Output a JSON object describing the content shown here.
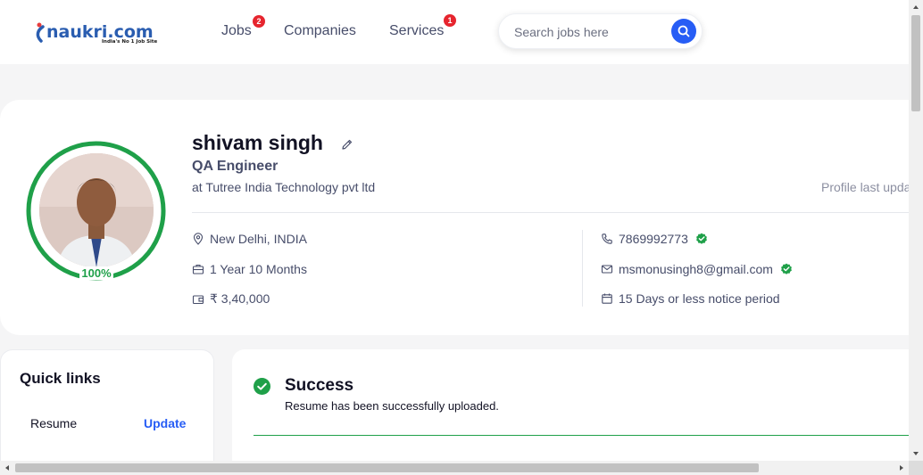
{
  "header": {
    "logo_text": "naukri.com",
    "logo_tagline": "India's No 1 Job Site",
    "nav": [
      {
        "label": "Jobs",
        "badge": "2"
      },
      {
        "label": "Companies",
        "badge": ""
      },
      {
        "label": "Services",
        "badge": "1"
      }
    ],
    "search_placeholder": "Search jobs here",
    "search_icon": "search-icon"
  },
  "profile": {
    "name": "shivam singh",
    "designation": "QA Engineer",
    "company": "at Tutree India Technology pvt ltd",
    "last_updated": "Profile last upda",
    "completion": "100%",
    "completion_value": 1.0,
    "location": "New Delhi, INDIA",
    "experience": "1 Year 10 Months",
    "salary": "₹ 3,40,000",
    "phone": "7869992773",
    "email": "msmonusingh8@gmail.com",
    "notice_period": "15 Days or less notice period",
    "phone_verified": true,
    "email_verified": true
  },
  "quick_links": {
    "title": "Quick links",
    "items": [
      {
        "label": "Resume",
        "action": "Update"
      }
    ]
  },
  "success": {
    "title": "Success",
    "message": "Resume has been successfully uploaded."
  },
  "colors": {
    "brand_blue": "#275df5",
    "success_green": "#1fa049",
    "badge_red": "#e6252e"
  }
}
